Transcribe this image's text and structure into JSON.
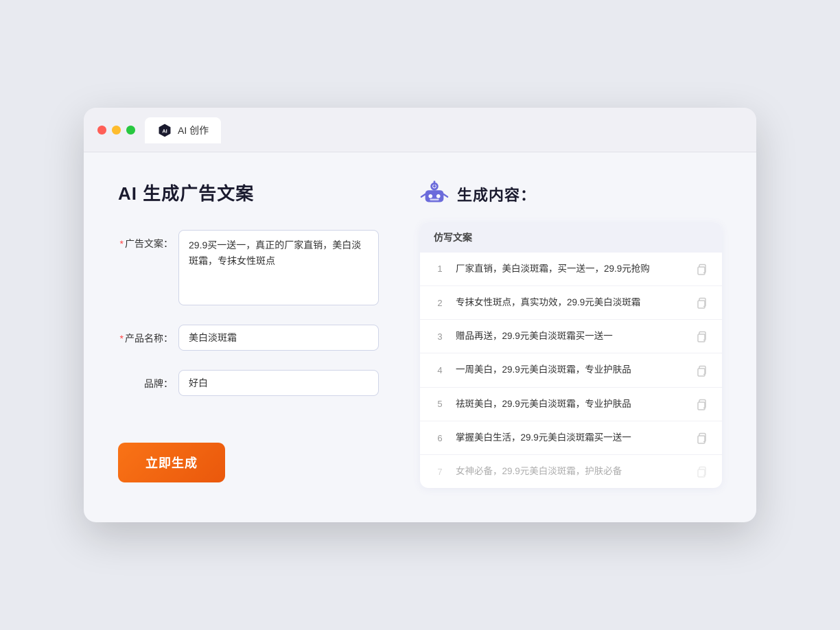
{
  "browser": {
    "tab_label": "AI 创作"
  },
  "page": {
    "title": "AI 生成广告文案",
    "right_title": "生成内容："
  },
  "form": {
    "ad_copy_label": "广告文案：",
    "ad_copy_required": "*",
    "ad_copy_value": "29.9买一送一，真正的厂家直销，美白淡斑霜，专抹女性斑点",
    "product_name_label": "产品名称：",
    "product_name_required": "*",
    "product_name_value": "美白淡斑霜",
    "brand_label": "品牌：",
    "brand_value": "好白",
    "generate_button": "立即生成"
  },
  "results": {
    "header": "仿写文案",
    "items": [
      {
        "num": "1",
        "text": "厂家直销，美白淡斑霜，买一送一，29.9元抢购",
        "faded": false
      },
      {
        "num": "2",
        "text": "专抹女性斑点，真实功效，29.9元美白淡斑霜",
        "faded": false
      },
      {
        "num": "3",
        "text": "赠品再送，29.9元美白淡斑霜买一送一",
        "faded": false
      },
      {
        "num": "4",
        "text": "一周美白，29.9元美白淡斑霜，专业护肤品",
        "faded": false
      },
      {
        "num": "5",
        "text": "祛斑美白，29.9元美白淡斑霜，专业护肤品",
        "faded": false
      },
      {
        "num": "6",
        "text": "掌握美白生活，29.9元美白淡斑霜买一送一",
        "faded": false
      },
      {
        "num": "7",
        "text": "女神必备，29.9元美白淡斑霜，护肤必备",
        "faded": true
      }
    ]
  }
}
